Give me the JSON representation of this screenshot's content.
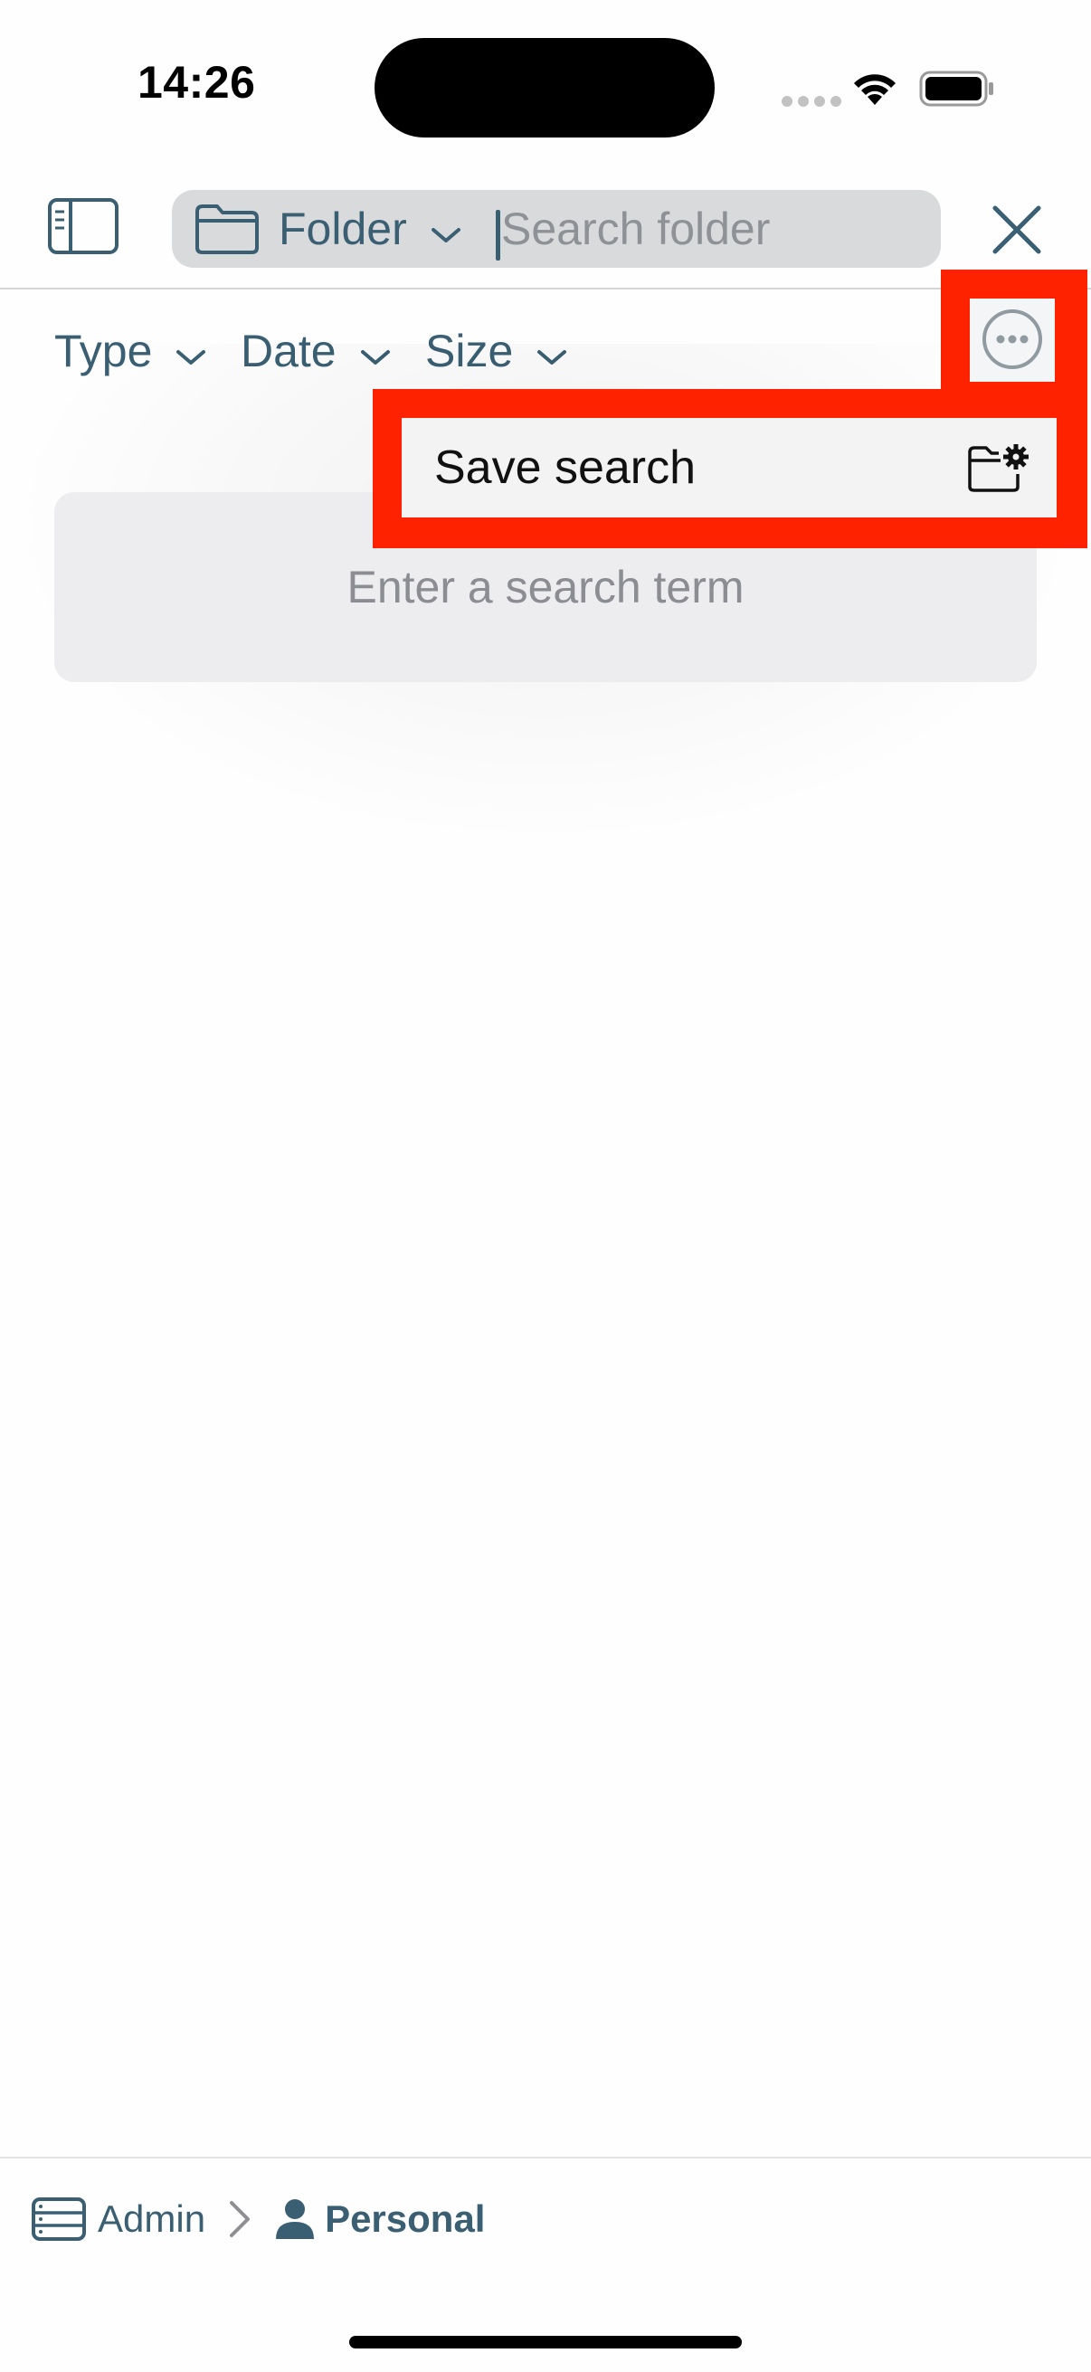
{
  "status_bar": {
    "time": "14:26"
  },
  "toolbar": {
    "sidebar_icon": "sidebar-left-icon",
    "scope_icon": "folder-icon",
    "scope_label": "Folder",
    "search_placeholder": "Search folder",
    "search_value": "",
    "close_icon": "close-icon"
  },
  "filters": {
    "type_label": "Type",
    "date_label": "Date",
    "size_label": "Size",
    "more_icon": "ellipsis-circle-icon"
  },
  "menu": {
    "items": [
      {
        "label": "Save search",
        "icon": "folder-gear-icon"
      }
    ]
  },
  "main": {
    "empty_message": "Enter a search term"
  },
  "breadcrumb": {
    "root_icon": "server-icon",
    "root_label": "Admin",
    "separator_icon": "chevron-right-icon",
    "current_icon": "person-icon",
    "current_label": "Personal"
  },
  "colors": {
    "accent": "#3a5f73",
    "highlight": "#ff2200",
    "search_field": "#d9dadc",
    "empty_card": "#ededf0"
  }
}
